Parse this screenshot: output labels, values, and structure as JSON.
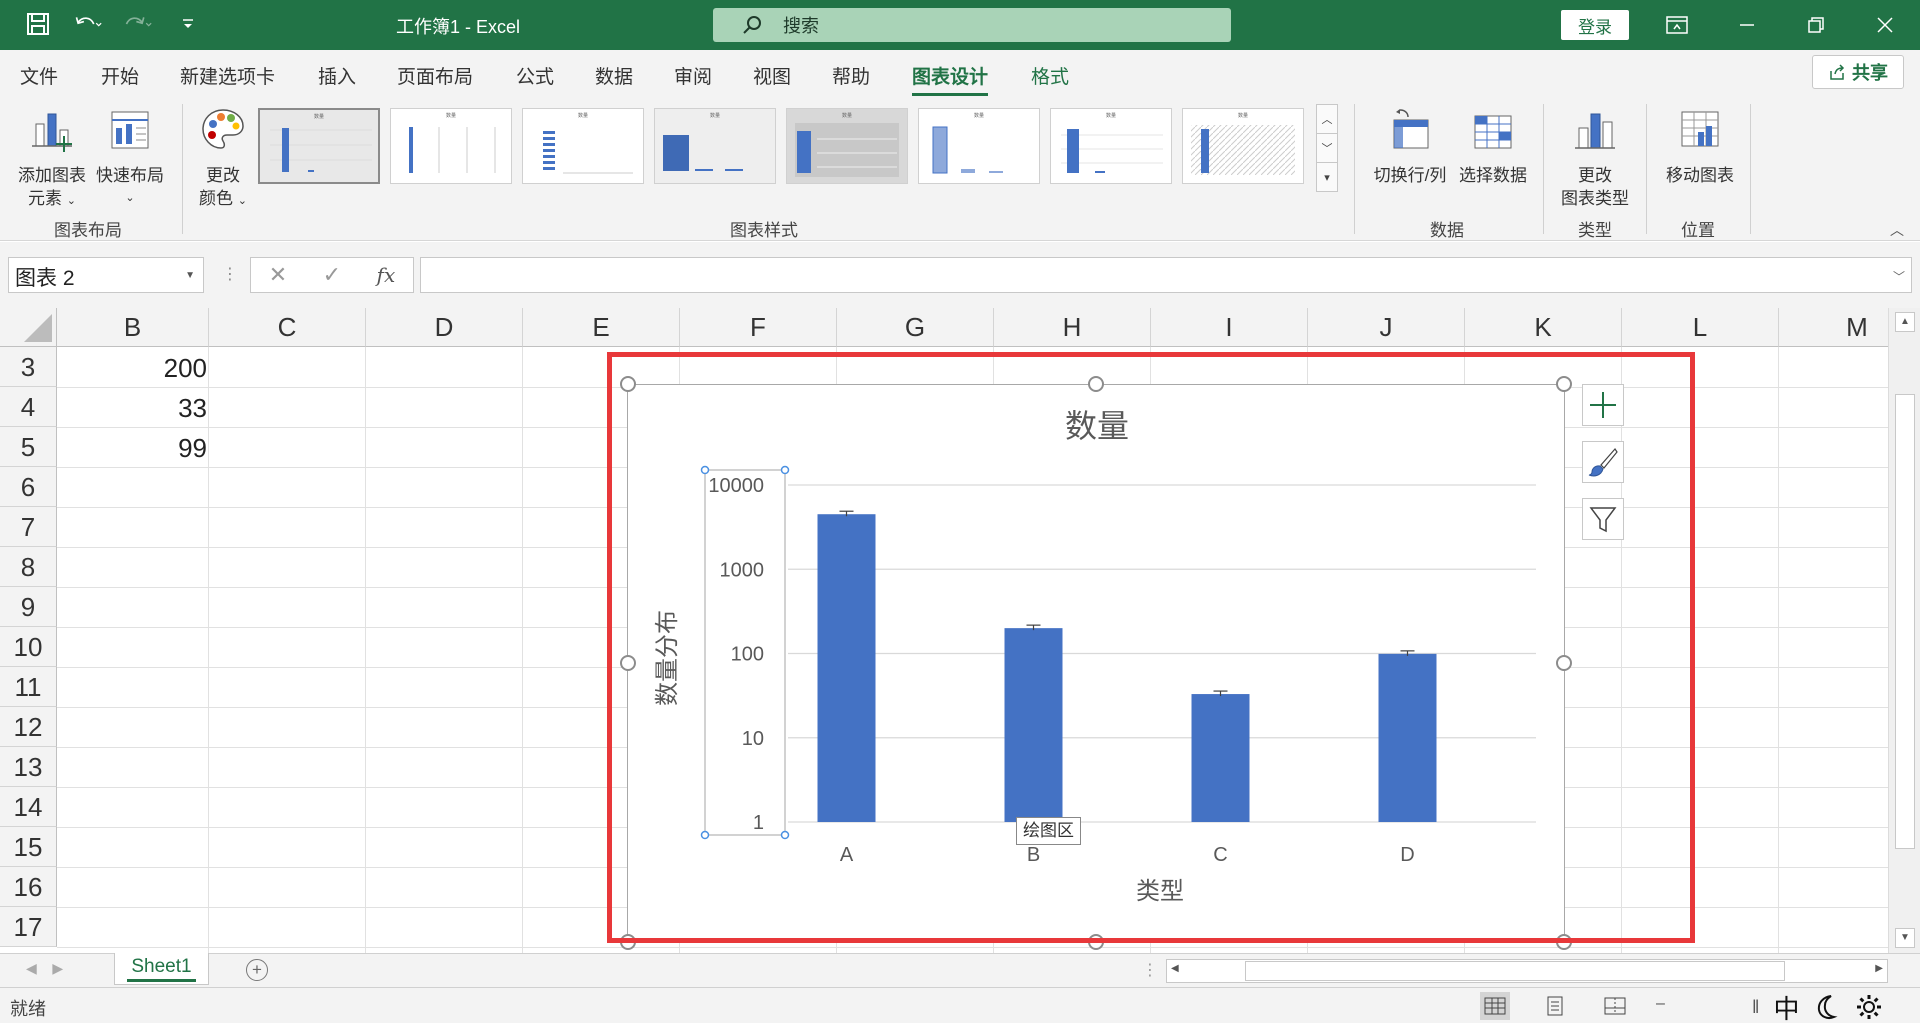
{
  "titlebar": {
    "doc_title": "工作簿1  -  Excel",
    "search_placeholder": "搜索",
    "login_label": "登录"
  },
  "tabs": [
    {
      "label": "文件"
    },
    {
      "label": "开始"
    },
    {
      "label": "新建选项卡"
    },
    {
      "label": "插入"
    },
    {
      "label": "页面布局"
    },
    {
      "label": "公式"
    },
    {
      "label": "数据"
    },
    {
      "label": "审阅"
    },
    {
      "label": "视图"
    },
    {
      "label": "帮助"
    },
    {
      "label": "图表设计"
    },
    {
      "label": "格式"
    }
  ],
  "share_label": "共享",
  "ribbon": {
    "add_element_line1": "添加图表",
    "add_element_line2": "元素",
    "quick_layout": "快速布局",
    "change_color_line1": "更改",
    "change_color_line2": "颜色",
    "group_layout": "图表布局",
    "group_styles": "图表样式",
    "switch_rowcol": "切换行/列",
    "select_data": "选择数据",
    "group_data": "数据",
    "change_type_line1": "更改",
    "change_type_line2": "图表类型",
    "group_type": "类型",
    "move_chart": "移动图表",
    "group_location": "位置",
    "style_thumb_titles": [
      "数量",
      "数量",
      "数量",
      "数量",
      "数量",
      "数量",
      "数量",
      "数量"
    ]
  },
  "formula_bar": {
    "name_box": "图表 2",
    "fx": "fx",
    "formula": ""
  },
  "grid": {
    "columns": [
      "B",
      "C",
      "D",
      "E",
      "F",
      "G",
      "H",
      "I",
      "J",
      "K",
      "L",
      "M"
    ],
    "rows": [
      "3",
      "4",
      "5",
      "6",
      "7",
      "8",
      "9",
      "10",
      "11",
      "12",
      "13",
      "14",
      "15",
      "16",
      "17"
    ],
    "cells_b": [
      "200",
      "33",
      "99"
    ]
  },
  "chart_data": {
    "type": "bar",
    "title": "数量",
    "xlabel": "类型",
    "ylabel": "数量分布",
    "categories": [
      "A",
      "B",
      "C",
      "D"
    ],
    "values": [
      4500,
      200,
      33,
      99
    ],
    "y_scale": "log",
    "ylim": [
      1,
      10000
    ],
    "y_ticks": [
      "1",
      "10",
      "100",
      "1000",
      "10000"
    ],
    "error_bars": true,
    "grid": true,
    "bar_color": "#4472C4"
  },
  "tooltip": "绘图区",
  "sheets": {
    "active": "Sheet1"
  },
  "status": {
    "text": "就绪",
    "ime_label": "中"
  },
  "colors": {
    "excel_green": "#217346",
    "selection_red": "#E8383A"
  }
}
